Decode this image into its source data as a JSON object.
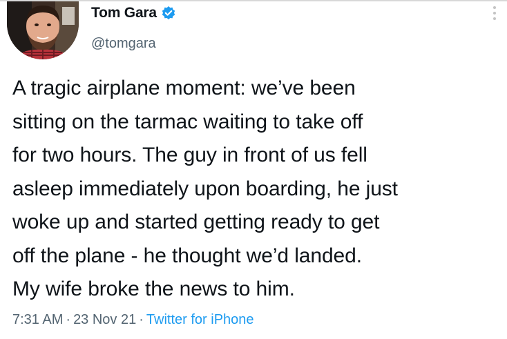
{
  "author": {
    "display_name": "Tom Gara",
    "handle": "@tomgara",
    "verified": true
  },
  "tweet": {
    "lines": [
      "A tragic airplane moment: we’ve been",
      "sitting on the tarmac waiting to take off",
      "for two hours. The guy in front of us fell",
      "asleep immediately upon boarding, he just",
      "woke up and started getting ready to get",
      "off the plane - he thought we’d landed.",
      "My wife broke the news to him."
    ]
  },
  "meta": {
    "time": "7:31 AM",
    "separator": "·",
    "date": "23 Nov 21",
    "source": "Twitter for iPhone"
  },
  "icons": {
    "verified": "verified-badge-icon",
    "more": "more-options-icon"
  },
  "colors": {
    "verified": "#1d9bf0",
    "source_link": "#1d9bf0",
    "secondary_text": "#536471",
    "primary_text": "#0f1419"
  }
}
